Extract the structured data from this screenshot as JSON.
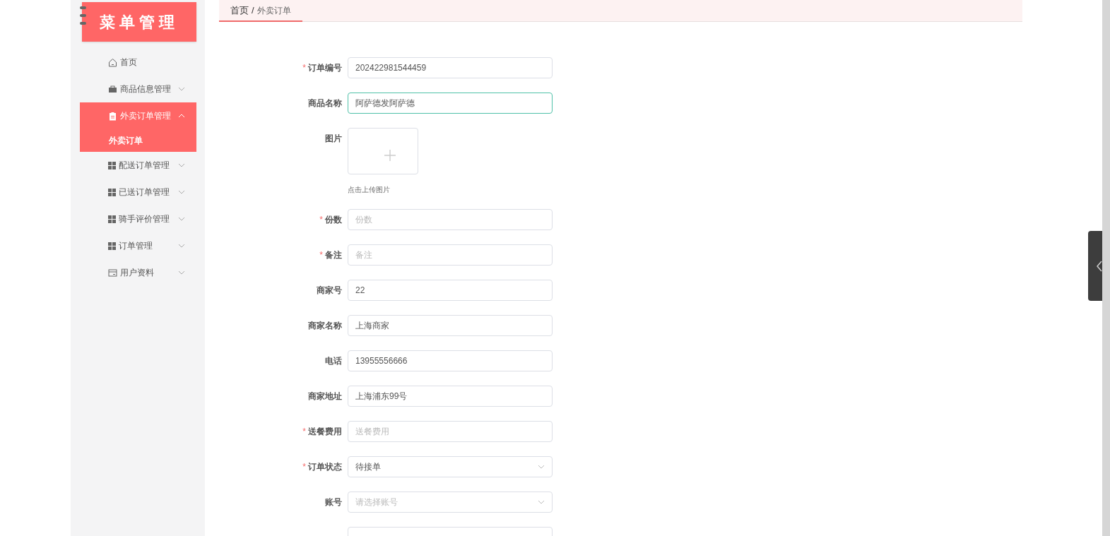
{
  "sidebar": {
    "logo_title": "菜单管理",
    "menu": [
      {
        "label": "首页",
        "expandable": false,
        "selected": false
      },
      {
        "label": "商品信息管理",
        "expandable": true,
        "expanded": false,
        "selected": false
      },
      {
        "label": "外卖订单管理",
        "expandable": true,
        "expanded": true,
        "selected": true,
        "children": [
          {
            "label": "外卖订单",
            "selected": true
          }
        ]
      },
      {
        "label": "配送订单管理",
        "expandable": true,
        "expanded": false,
        "selected": false
      },
      {
        "label": "已送订单管理",
        "expandable": true,
        "expanded": false,
        "selected": false
      },
      {
        "label": "骑手评价管理",
        "expandable": true,
        "expanded": false,
        "selected": false
      },
      {
        "label": "订单管理",
        "expandable": true,
        "expanded": false,
        "selected": false
      },
      {
        "label": "用户资料",
        "expandable": true,
        "expanded": false,
        "selected": false
      }
    ]
  },
  "breadcrumb": {
    "home": "首页",
    "separator": "/",
    "current": "外卖订单"
  },
  "form": {
    "required_mark": "*",
    "fields": [
      {
        "kind": "input",
        "label": "订单编号",
        "required": true,
        "value": "202422981544459",
        "focused": false
      },
      {
        "kind": "input",
        "label": "商品名称",
        "required": false,
        "value": "阿萨德发阿萨德",
        "focused": true
      },
      {
        "kind": "upload",
        "label": "图片",
        "required": false,
        "hint": "点击上传图片"
      },
      {
        "kind": "input",
        "label": "份数",
        "required": true,
        "placeholder": "份数",
        "focused": false
      },
      {
        "kind": "input",
        "label": "备注",
        "required": true,
        "placeholder": "备注",
        "focused": false
      },
      {
        "kind": "input",
        "label": "商家号",
        "required": false,
        "value": "22",
        "focused": false
      },
      {
        "kind": "input",
        "label": "商家名称",
        "required": false,
        "value": "上海商家",
        "focused": false
      },
      {
        "kind": "input",
        "label": "电话",
        "required": false,
        "value": "13955556666",
        "focused": false
      },
      {
        "kind": "input",
        "label": "商家地址",
        "required": false,
        "value": "上海浦东99号",
        "focused": false
      },
      {
        "kind": "input",
        "label": "送餐费用",
        "required": true,
        "placeholder": "送餐费用",
        "focused": false
      },
      {
        "kind": "select",
        "label": "订单状态",
        "required": true,
        "value": "待接单"
      },
      {
        "kind": "select",
        "label": "账号",
        "required": false,
        "placeholder": "请选择账号"
      },
      {
        "kind": "input",
        "focused": false
      }
    ]
  }
}
